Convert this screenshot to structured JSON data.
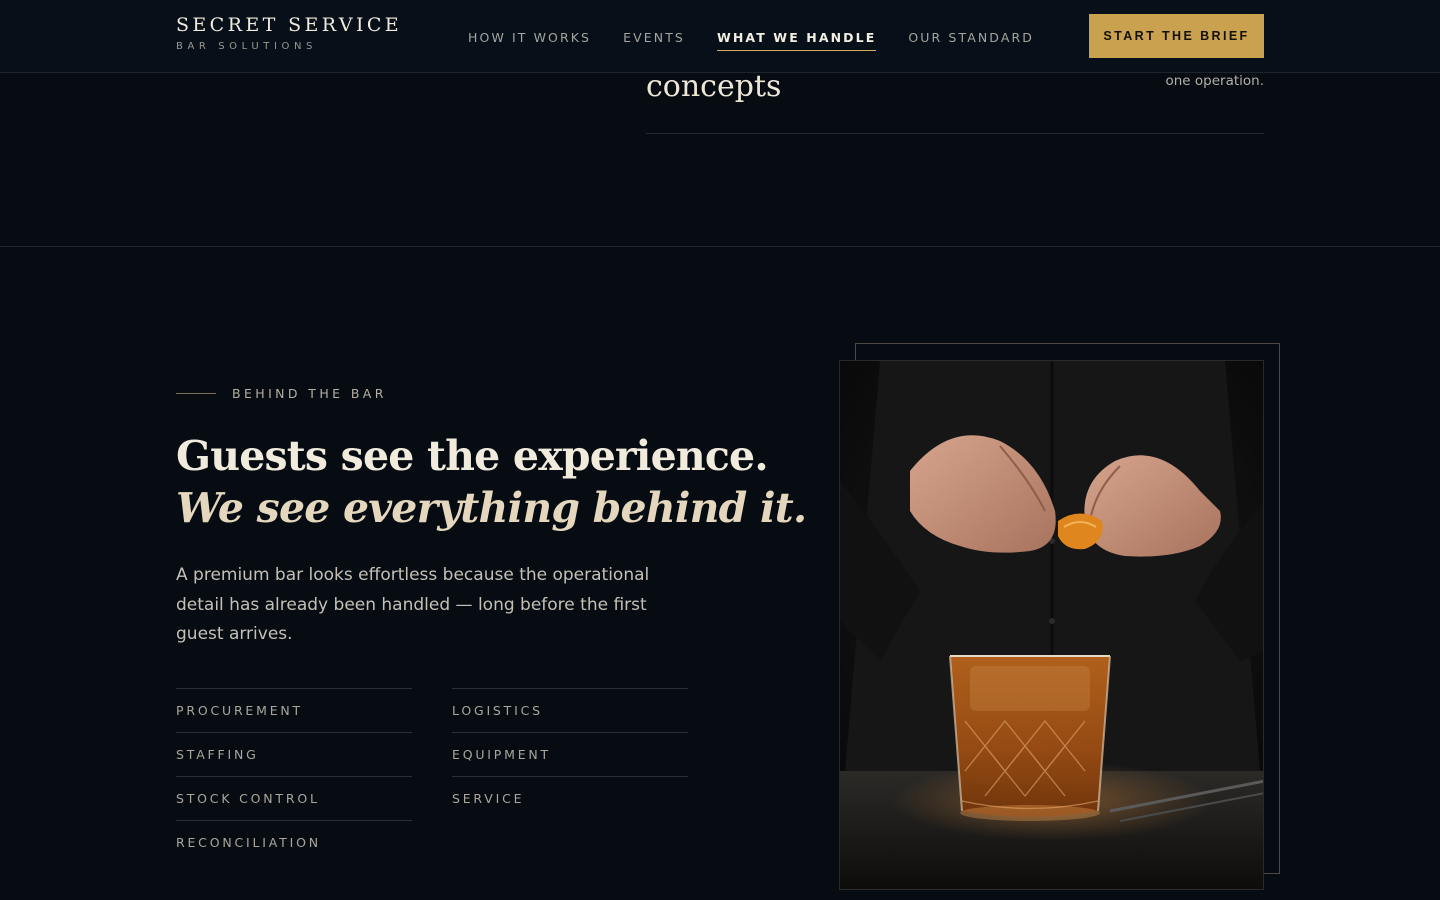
{
  "brand": {
    "name": "SECRET SERVICE",
    "tagline": "BAR SOLUTIONS"
  },
  "nav": {
    "items": [
      {
        "label": "HOW IT WORKS",
        "active": false
      },
      {
        "label": "EVENTS",
        "active": false
      },
      {
        "label": "WHAT WE HANDLE",
        "active": true
      },
      {
        "label": "OUR STANDARD",
        "active": false
      }
    ],
    "cta_label": "START THE BRIEF"
  },
  "previous_section": {
    "heading_tail": "concepts",
    "note_tail": "one operation."
  },
  "behind_the_bar": {
    "eyebrow": "BEHIND THE BAR",
    "headline_line1": "Guests see the experience.",
    "headline_line2": "We see everything behind it.",
    "body": "A premium bar looks effortless because the operational detail has already been handled — long before the first guest arrives.",
    "services_left": [
      "PROCUREMENT",
      "STAFFING",
      "STOCK CONTROL",
      "RECONCILIATION"
    ],
    "services_right": [
      "LOGISTICS",
      "EQUIPMENT",
      "SERVICE"
    ],
    "image_subject": "bartender garnishing cocktail with orange peel"
  },
  "colors": {
    "background": "#060c12",
    "accent_gold": "#c9a14f",
    "text_primary": "#f1ebdd"
  }
}
